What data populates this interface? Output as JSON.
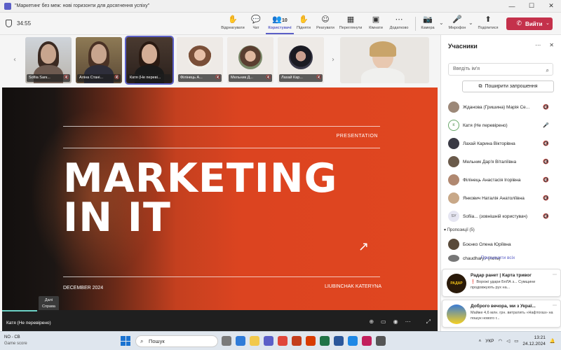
{
  "window": {
    "title": "\"Маркетинг без меж: нові горизонти для досягнення успіху\"",
    "minimize": "—",
    "maximize": "☐",
    "close": "✕"
  },
  "toolbar": {
    "timer": "34:55",
    "buttons": [
      {
        "name": "Відреагувати",
        "icon": "✋"
      },
      {
        "name": "Чат",
        "icon": "💬"
      },
      {
        "name": "Користувачі",
        "icon": "👥",
        "count": "10"
      },
      {
        "name": "Підняти",
        "icon": "✋"
      },
      {
        "name": "Реагувати",
        "icon": "☺"
      },
      {
        "name": "Переглянути",
        "icon": "▦"
      },
      {
        "name": "Кімнати",
        "icon": "▣"
      },
      {
        "name": "Додатково",
        "icon": "⋯"
      },
      {
        "name": "Камера",
        "icon": "📷"
      },
      {
        "name": "Мікрофон",
        "icon": "🎤"
      },
      {
        "name": "Поділитися",
        "icon": "⬆"
      }
    ],
    "leave": "Вийти"
  },
  "strip": {
    "participants": [
      {
        "name": "Sofiia Sarк..."
      },
      {
        "name": "Аліна Стані..."
      },
      {
        "name": "Катя (Не переві..."
      },
      {
        "name": "Філінець А..."
      },
      {
        "name": "Мельник Д..."
      },
      {
        "name": "Лахай Кар..."
      }
    ]
  },
  "slide": {
    "label": "PRESENTATION",
    "title_line1": "MARKETING",
    "title_line2": "IN IT",
    "date": "DECEMBER 2024",
    "author": "LIUBINCHAK KATERYNA"
  },
  "presenter": {
    "name": "Катя (Не перевірено)",
    "tooltip_line1": "Далі",
    "tooltip_line2": "Справа"
  },
  "panel": {
    "title": "Учасники",
    "search_placeholder": "Введіть ім'я",
    "share_invite": "Поширити запрошення",
    "participants": [
      {
        "name": "Жданова (Гришина) Марія Се...",
        "initials": ""
      },
      {
        "name": "Катя (Не перевірено)",
        "initials": "К"
      },
      {
        "name": "Лахай Карина Вікторівна",
        "initials": ""
      },
      {
        "name": "Мельник Дар'я Віталіївна",
        "initials": ""
      },
      {
        "name": "Філінець Анастасія Ігорівна",
        "initials": ""
      },
      {
        "name": "Янкович Наталія Анатоліївна",
        "initials": ""
      },
      {
        "name": "Sofiia... (зовнішній користувач)",
        "initials": "SY"
      }
    ],
    "suggested_label": "Пропозиції (5)",
    "suggested_person": "Боєнко Олена Юріївна",
    "invite_all": "Призначити всіх",
    "partial_person": "chaudhary? (гість)"
  },
  "notifications": [
    {
      "title": "Радар ранет | Карта тривог",
      "body": "❗ Ворожі удари БпЛА з... Сумщини продовжують рух на...",
      "logo_text": "РАДАР"
    },
    {
      "title": "Доброго вечора, ми з Украї...",
      "body": "Майже 4,6 млн. грн. витратить «Нафтогаз» на пошук нового г..."
    }
  ],
  "taskbar": {
    "weather_temp": "NO - CB",
    "weather_desc": "Game score",
    "search": "Пошук",
    "lang": "УКР",
    "time": "13:21",
    "date": "24.12.2024"
  },
  "colors": {
    "accent": "#5b5fc7",
    "leave": "#c4314b",
    "slide_orange": "#e04620"
  }
}
